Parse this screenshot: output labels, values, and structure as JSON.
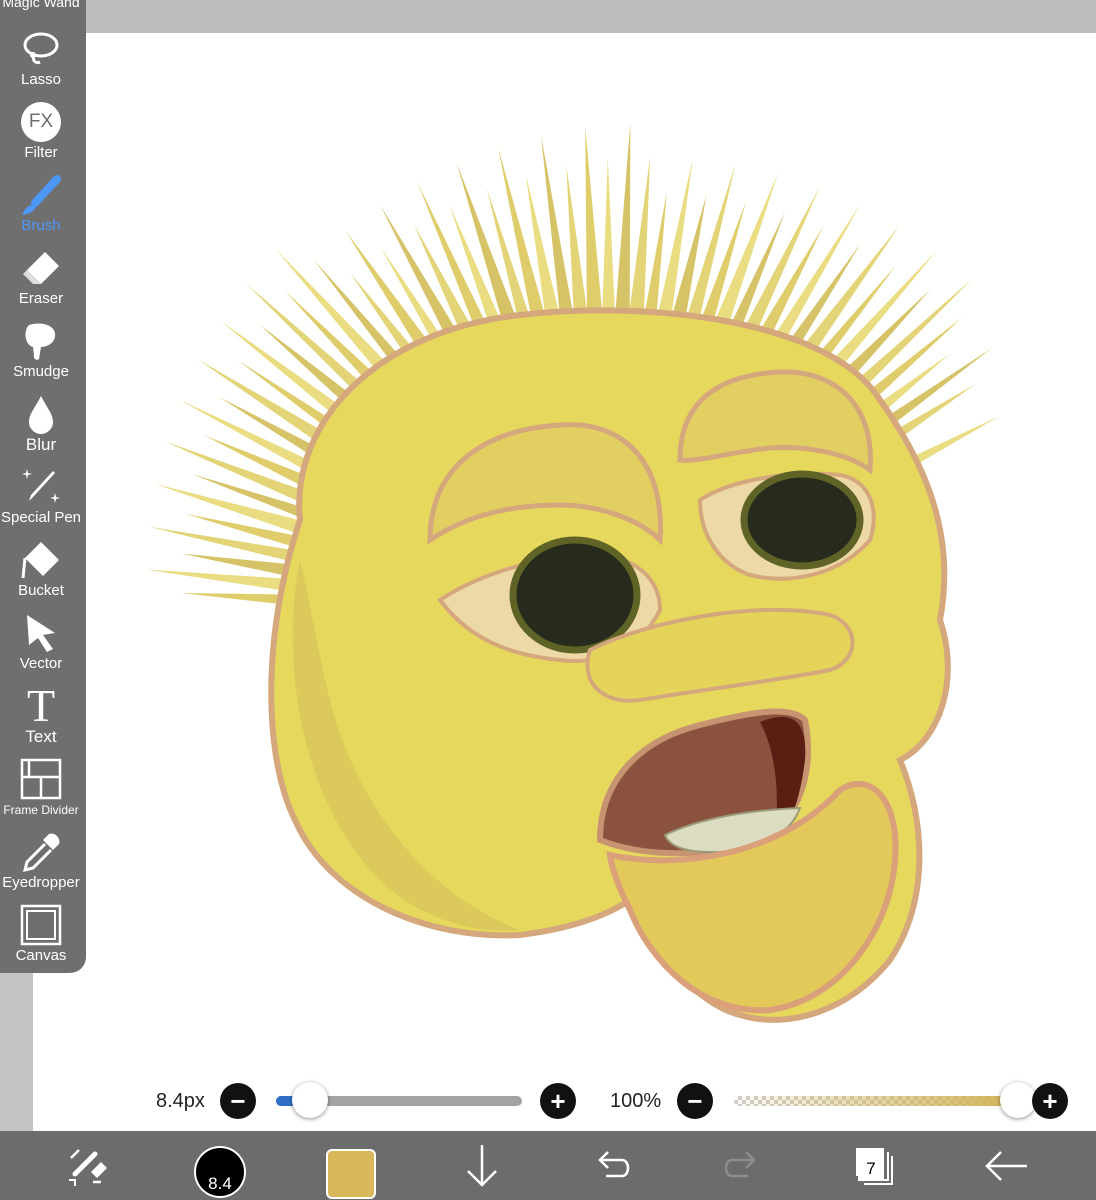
{
  "toolbar": {
    "cut_label": "Magic Wand",
    "tools": [
      {
        "label": "Lasso",
        "icon": "lasso-icon"
      },
      {
        "label": "Filter",
        "icon": "fx-icon",
        "glyph": "FX"
      },
      {
        "label": "Brush",
        "icon": "brush-icon",
        "active": true
      },
      {
        "label": "Eraser",
        "icon": "eraser-icon"
      },
      {
        "label": "Smudge",
        "icon": "smudge-icon"
      },
      {
        "label": "Blur",
        "icon": "drop-icon"
      },
      {
        "label": "Special Pen",
        "icon": "special-pen-icon"
      },
      {
        "label": "Bucket",
        "icon": "bucket-icon"
      },
      {
        "label": "Vector",
        "icon": "arrow-cursor-icon"
      },
      {
        "label": "Text",
        "icon": "text-icon",
        "glyph": "T"
      },
      {
        "label": "Frame Divider",
        "icon": "frame-divider-icon"
      },
      {
        "label": "Eyedropper",
        "icon": "eyedropper-icon"
      },
      {
        "label": "Canvas",
        "icon": "canvas-icon"
      }
    ],
    "active_color": "#4d97f5"
  },
  "sliders": {
    "size_value": "8.4px",
    "size_fraction": 0.14,
    "opacity_value": "100%",
    "opacity_fraction": 1.0,
    "minus_glyph": "−",
    "plus_glyph": "+"
  },
  "bottombar": {
    "brush_size_label": "8.4",
    "current_color": "#d9b85c",
    "layer_count": "7",
    "icons": [
      "transform-icon",
      "brush-size-icon",
      "color-swatch",
      "download-arrow-icon",
      "undo-icon",
      "redo-icon",
      "layers-icon",
      "back-arrow-icon"
    ]
  }
}
